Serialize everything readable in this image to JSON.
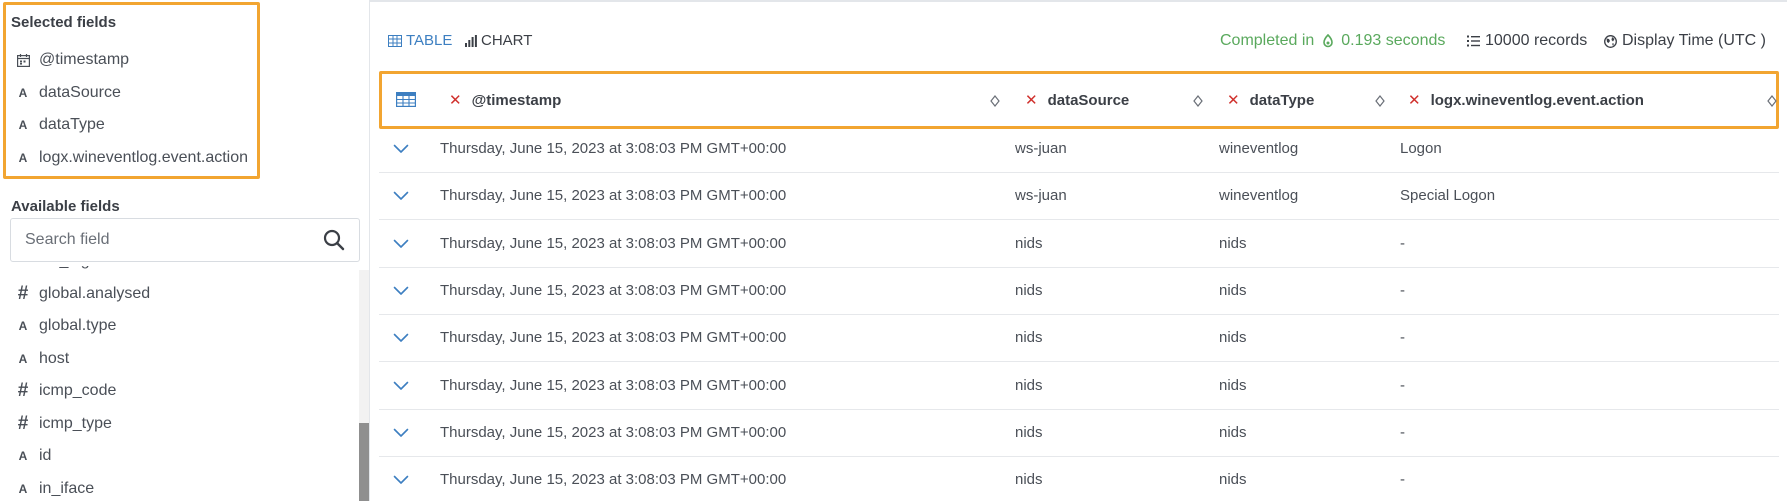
{
  "sidebar": {
    "selected_title": "Selected fields",
    "selected_fields": [
      {
        "type": "date",
        "name": "@timestamp"
      },
      {
        "type": "text",
        "name": "dataSource"
      },
      {
        "type": "text",
        "name": "dataType"
      },
      {
        "type": "text",
        "name": "logx.wineventlog.event.action"
      }
    ],
    "available_title": "Available fields",
    "search_placeholder": "Search field",
    "available_fields": [
      {
        "type": "text",
        "name": "full_log"
      },
      {
        "type": "number",
        "name": "global.analysed"
      },
      {
        "type": "text",
        "name": "global.type"
      },
      {
        "type": "text",
        "name": "host"
      },
      {
        "type": "number",
        "name": "icmp_code"
      },
      {
        "type": "number",
        "name": "icmp_type"
      },
      {
        "type": "text",
        "name": "id"
      },
      {
        "type": "text",
        "name": "in_iface"
      }
    ],
    "type_glyphs": {
      "text": "A",
      "number": "#"
    }
  },
  "toolbar": {
    "tab_table": "TABLE",
    "tab_chart": "CHART",
    "completed_prefix": "Completed in",
    "completed_value": "0.193 seconds",
    "records": "10000 records",
    "display_time": "Display Time (UTC )"
  },
  "table": {
    "columns": [
      "@timestamp",
      "dataSource",
      "dataType",
      "logx.wineventlog.event.action"
    ],
    "rows": [
      [
        "Thursday, June 15, 2023 at 3:08:03 PM GMT+00:00",
        "ws-juan",
        "wineventlog",
        "Logon"
      ],
      [
        "Thursday, June 15, 2023 at 3:08:03 PM GMT+00:00",
        "ws-juan",
        "wineventlog",
        "Special Logon"
      ],
      [
        "Thursday, June 15, 2023 at 3:08:03 PM GMT+00:00",
        "nids",
        "nids",
        "-"
      ],
      [
        "Thursday, June 15, 2023 at 3:08:03 PM GMT+00:00",
        "nids",
        "nids",
        "-"
      ],
      [
        "Thursday, June 15, 2023 at 3:08:03 PM GMT+00:00",
        "nids",
        "nids",
        "-"
      ],
      [
        "Thursday, June 15, 2023 at 3:08:03 PM GMT+00:00",
        "nids",
        "nids",
        "-"
      ],
      [
        "Thursday, June 15, 2023 at 3:08:03 PM GMT+00:00",
        "nids",
        "nids",
        "-"
      ],
      [
        "Thursday, June 15, 2023 at 3:08:03 PM GMT+00:00",
        "nids",
        "nids",
        "-"
      ]
    ]
  },
  "colors": {
    "accent_blue": "#3d7fc1",
    "highlight_orange": "#f2a531",
    "remove_red": "#d0312d",
    "success_green": "#5aa95d"
  },
  "icons": {
    "table_tab": "table-icon",
    "chart_tab": "bar-chart-icon",
    "completed": "gauge-icon",
    "records": "list-icon",
    "display_time": "globe-icon",
    "search": "search-icon",
    "row_expand": "chevron-down-icon",
    "column_sort": "sort-icon",
    "column_remove": "close-icon",
    "column_settings": "table-settings-icon",
    "date_field": "calendar-icon"
  }
}
